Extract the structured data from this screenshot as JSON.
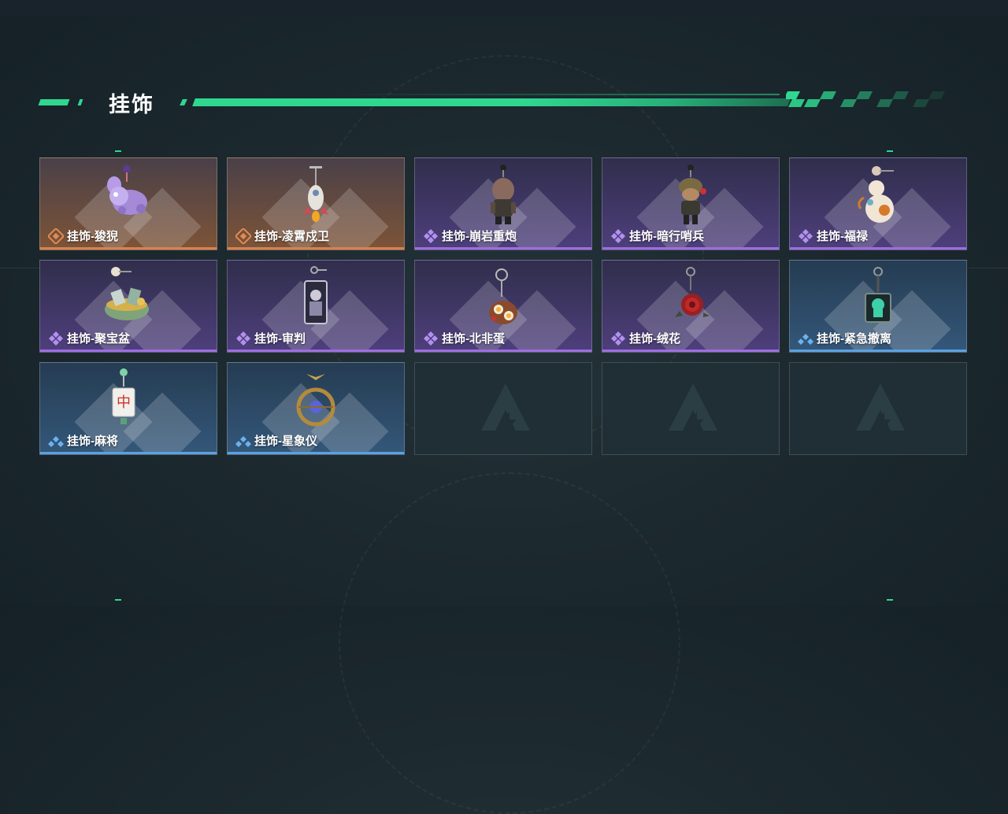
{
  "header": {
    "title": "挂饰"
  },
  "items": [
    {
      "label": "挂饰-狻猊",
      "rarity": "orange",
      "icon": "lion-charm-icon"
    },
    {
      "label": "挂饰-凌霄戍卫",
      "rarity": "orange",
      "icon": "rocket-charm-icon"
    },
    {
      "label": "挂饰-崩岩重炮",
      "rarity": "purple",
      "icon": "soldier-figure-charm-icon"
    },
    {
      "label": "挂饰-暗行哨兵",
      "rarity": "purple",
      "icon": "sentinel-figure-charm-icon"
    },
    {
      "label": "挂饰-福禄",
      "rarity": "purple",
      "icon": "gourd-charm-icon"
    },
    {
      "label": "挂饰-聚宝盆",
      "rarity": "purple",
      "icon": "treasure-bowl-charm-icon"
    },
    {
      "label": "挂饰-审判",
      "rarity": "purple",
      "icon": "judgment-card-charm-icon"
    },
    {
      "label": "挂饰-北非蛋",
      "rarity": "purple",
      "icon": "shakshuka-charm-icon"
    },
    {
      "label": "挂饰-绒花",
      "rarity": "purple",
      "icon": "rose-charm-icon"
    },
    {
      "label": "挂饰-紧急撤离",
      "rarity": "blue",
      "icon": "evacuation-tag-charm-icon"
    },
    {
      "label": "挂饰-麻将",
      "rarity": "blue",
      "icon": "mahjong-tile-charm-icon"
    },
    {
      "label": "挂饰-星象仪",
      "rarity": "blue",
      "icon": "astrolabe-charm-icon"
    },
    {
      "label": "",
      "rarity": "empty",
      "icon": "empty-slot-logo-icon"
    },
    {
      "label": "",
      "rarity": "empty",
      "icon": "empty-slot-logo-icon"
    },
    {
      "label": "",
      "rarity": "empty",
      "icon": "empty-slot-logo-icon"
    }
  ],
  "colors": {
    "accent": "#2fd88f",
    "orange": "#d9824a",
    "purple": "#9d6ee0",
    "blue": "#5aa2e0"
  }
}
